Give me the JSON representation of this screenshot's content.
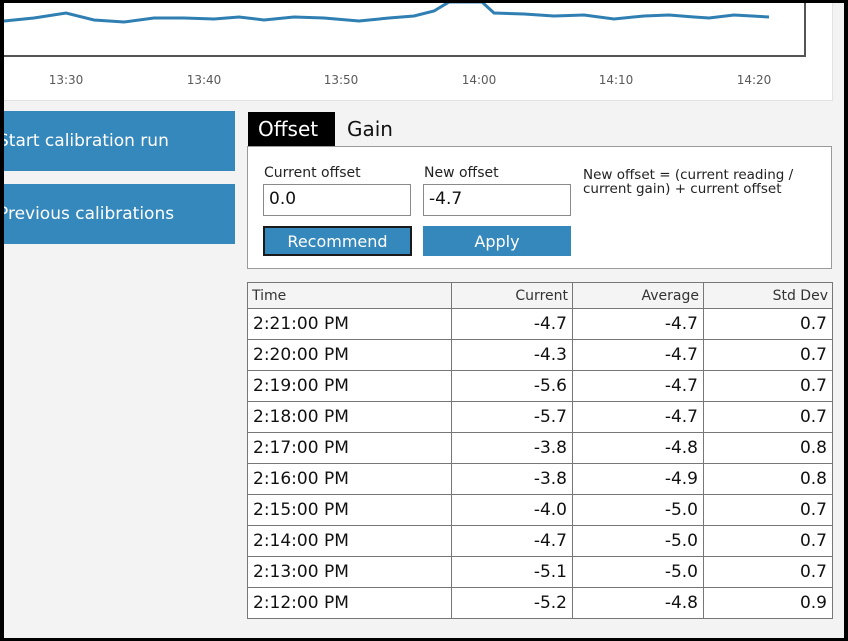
{
  "chart": {
    "x_ticks": [
      "13:30",
      "13:40",
      "13:50",
      "14:00",
      "14:10",
      "14:20"
    ],
    "line_color": "#2f7fb3"
  },
  "sidebar": {
    "start_run_label": "Start calibration run",
    "previous_label": "Previous calibrations"
  },
  "tabs": [
    {
      "label": "Offset",
      "active": true
    },
    {
      "label": "Gain",
      "active": false
    }
  ],
  "offset_panel": {
    "current_offset_label": "Current offset",
    "current_offset_value": "0.0",
    "new_offset_label": "New offset",
    "new_offset_value": "-4.7",
    "formula": "New offset = (current reading / current gain) + current offset",
    "recommend_label": "Recommend",
    "apply_label": "Apply"
  },
  "table": {
    "headers": [
      "Time",
      "Current",
      "Average",
      "Std Dev"
    ],
    "rows": [
      [
        "2:21:00 PM",
        "-4.7",
        "-4.7",
        "0.7"
      ],
      [
        "2:20:00 PM",
        "-4.3",
        "-4.7",
        "0.7"
      ],
      [
        "2:19:00 PM",
        "-5.6",
        "-4.7",
        "0.7"
      ],
      [
        "2:18:00 PM",
        "-5.7",
        "-4.7",
        "0.7"
      ],
      [
        "2:17:00 PM",
        "-3.8",
        "-4.8",
        "0.8"
      ],
      [
        "2:16:00 PM",
        "-3.8",
        "-4.9",
        "0.8"
      ],
      [
        "2:15:00 PM",
        "-4.0",
        "-5.0",
        "0.7"
      ],
      [
        "2:14:00 PM",
        "-4.7",
        "-5.0",
        "0.7"
      ],
      [
        "2:13:00 PM",
        "-5.1",
        "-5.0",
        "0.7"
      ],
      [
        "2:12:00 PM",
        "-5.2",
        "-4.8",
        "0.9"
      ]
    ]
  },
  "colors": {
    "accent": "#3588bc",
    "tab_active_bg": "#000000",
    "background": "#f3f3f3"
  }
}
